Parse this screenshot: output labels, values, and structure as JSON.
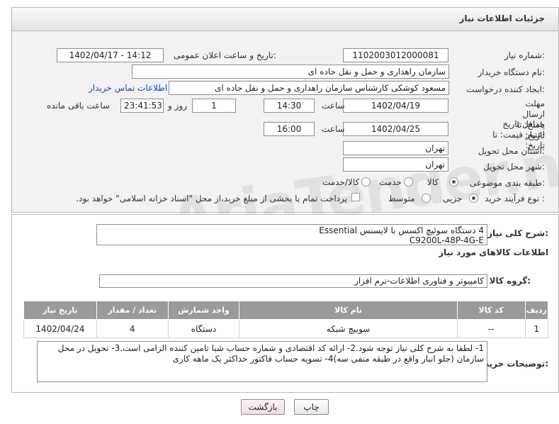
{
  "header": {
    "title": "جزئیات اطلاعات نیاز"
  },
  "fields": {
    "need_number_label": "شماره نیاز:",
    "need_number": "1102003012000081",
    "announce_label": "تاریخ و ساعت اعلان عمومی:",
    "announce_value": "1402/04/17 - 14:12",
    "buyer_org_label": "نام دستگاه خریدار:",
    "buyer_org": "سازمان راهداری و حمل و نقل جاده ای",
    "creator_label": "ایجاد کننده درخواست:",
    "creator": "مسعود کوشکی کارشناس  سازمان راهداری و حمل و نقل جاده ای",
    "buyer_contact_link": "اطلاعات تماس خریدار",
    "reply_deadline_label": "مهلت ارسال پاسخ: تا تاریخ:",
    "reply_date": "1402/04/19",
    "time_label": "ساعت",
    "reply_time": "14:30",
    "days_value": "1",
    "days_label": "روز و",
    "remaining_time": "23:41:53",
    "remaining_label": "ساعت باقی مانده",
    "price_validity_label": "حداقل تاریخ اعتبار قیمت: تا تاریخ:",
    "price_date": "1402/04/25",
    "price_time": "16:00",
    "province_label": "استان محل تحویل:",
    "province": "تهران",
    "city_label": "شهر محل تحویل:",
    "city": "تهران",
    "category_label": "طبقه بندی موضوعی:",
    "category_options": [
      "کالا",
      "خدمت",
      "کالا/خدمت"
    ],
    "purchase_type_label": "نوع فرآیند خرید :",
    "purchase_options": [
      "جزیی",
      "متوسط"
    ],
    "purchase_note": "پرداخت تمام یا بخشی از مبلغ خرید،از محل \"اسناد خزانه اسلامی\" خواهد بود."
  },
  "description": {
    "label": "شرح کلی نیاز:",
    "text_line1": "4 دستگاه سوئیچ اکسس با لایسنس Essential",
    "text_line2": "C9200L-48P-4G-E"
  },
  "goods_info": {
    "title": "اطلاعات کالاهای مورد نیاز",
    "group_label": "گروه کالا:",
    "group_value": "کامپیوتر و فناوری اطلاعات-نرم افزار"
  },
  "table": {
    "headers": [
      "ردیف",
      "کد کالا",
      "نام کالا",
      "واحد شمارش",
      "تعداد / مقدار",
      "تاریخ نیاز"
    ],
    "rows": [
      [
        "1",
        "--",
        "سوییچ شبکه",
        "دستگاه",
        "4",
        "1402/04/24"
      ]
    ]
  },
  "buyer_notes": {
    "label": "توضیحات خریدار:",
    "text": "1- لطفا به شرح کلی نیاز توجه شود.2- ارائه کد اقتصادی و شماره حساب شبا تامین کننده الزامی است.3- تحویل در محل سازمان (جلو انبار واقع در طبقه منفی سه)4- تسویه حساب فاکتور حداکثر یک ماهه کاری"
  },
  "buttons": {
    "print": "چاپ",
    "back": "بازگشت"
  },
  "watermark": "AriaTender.neT"
}
